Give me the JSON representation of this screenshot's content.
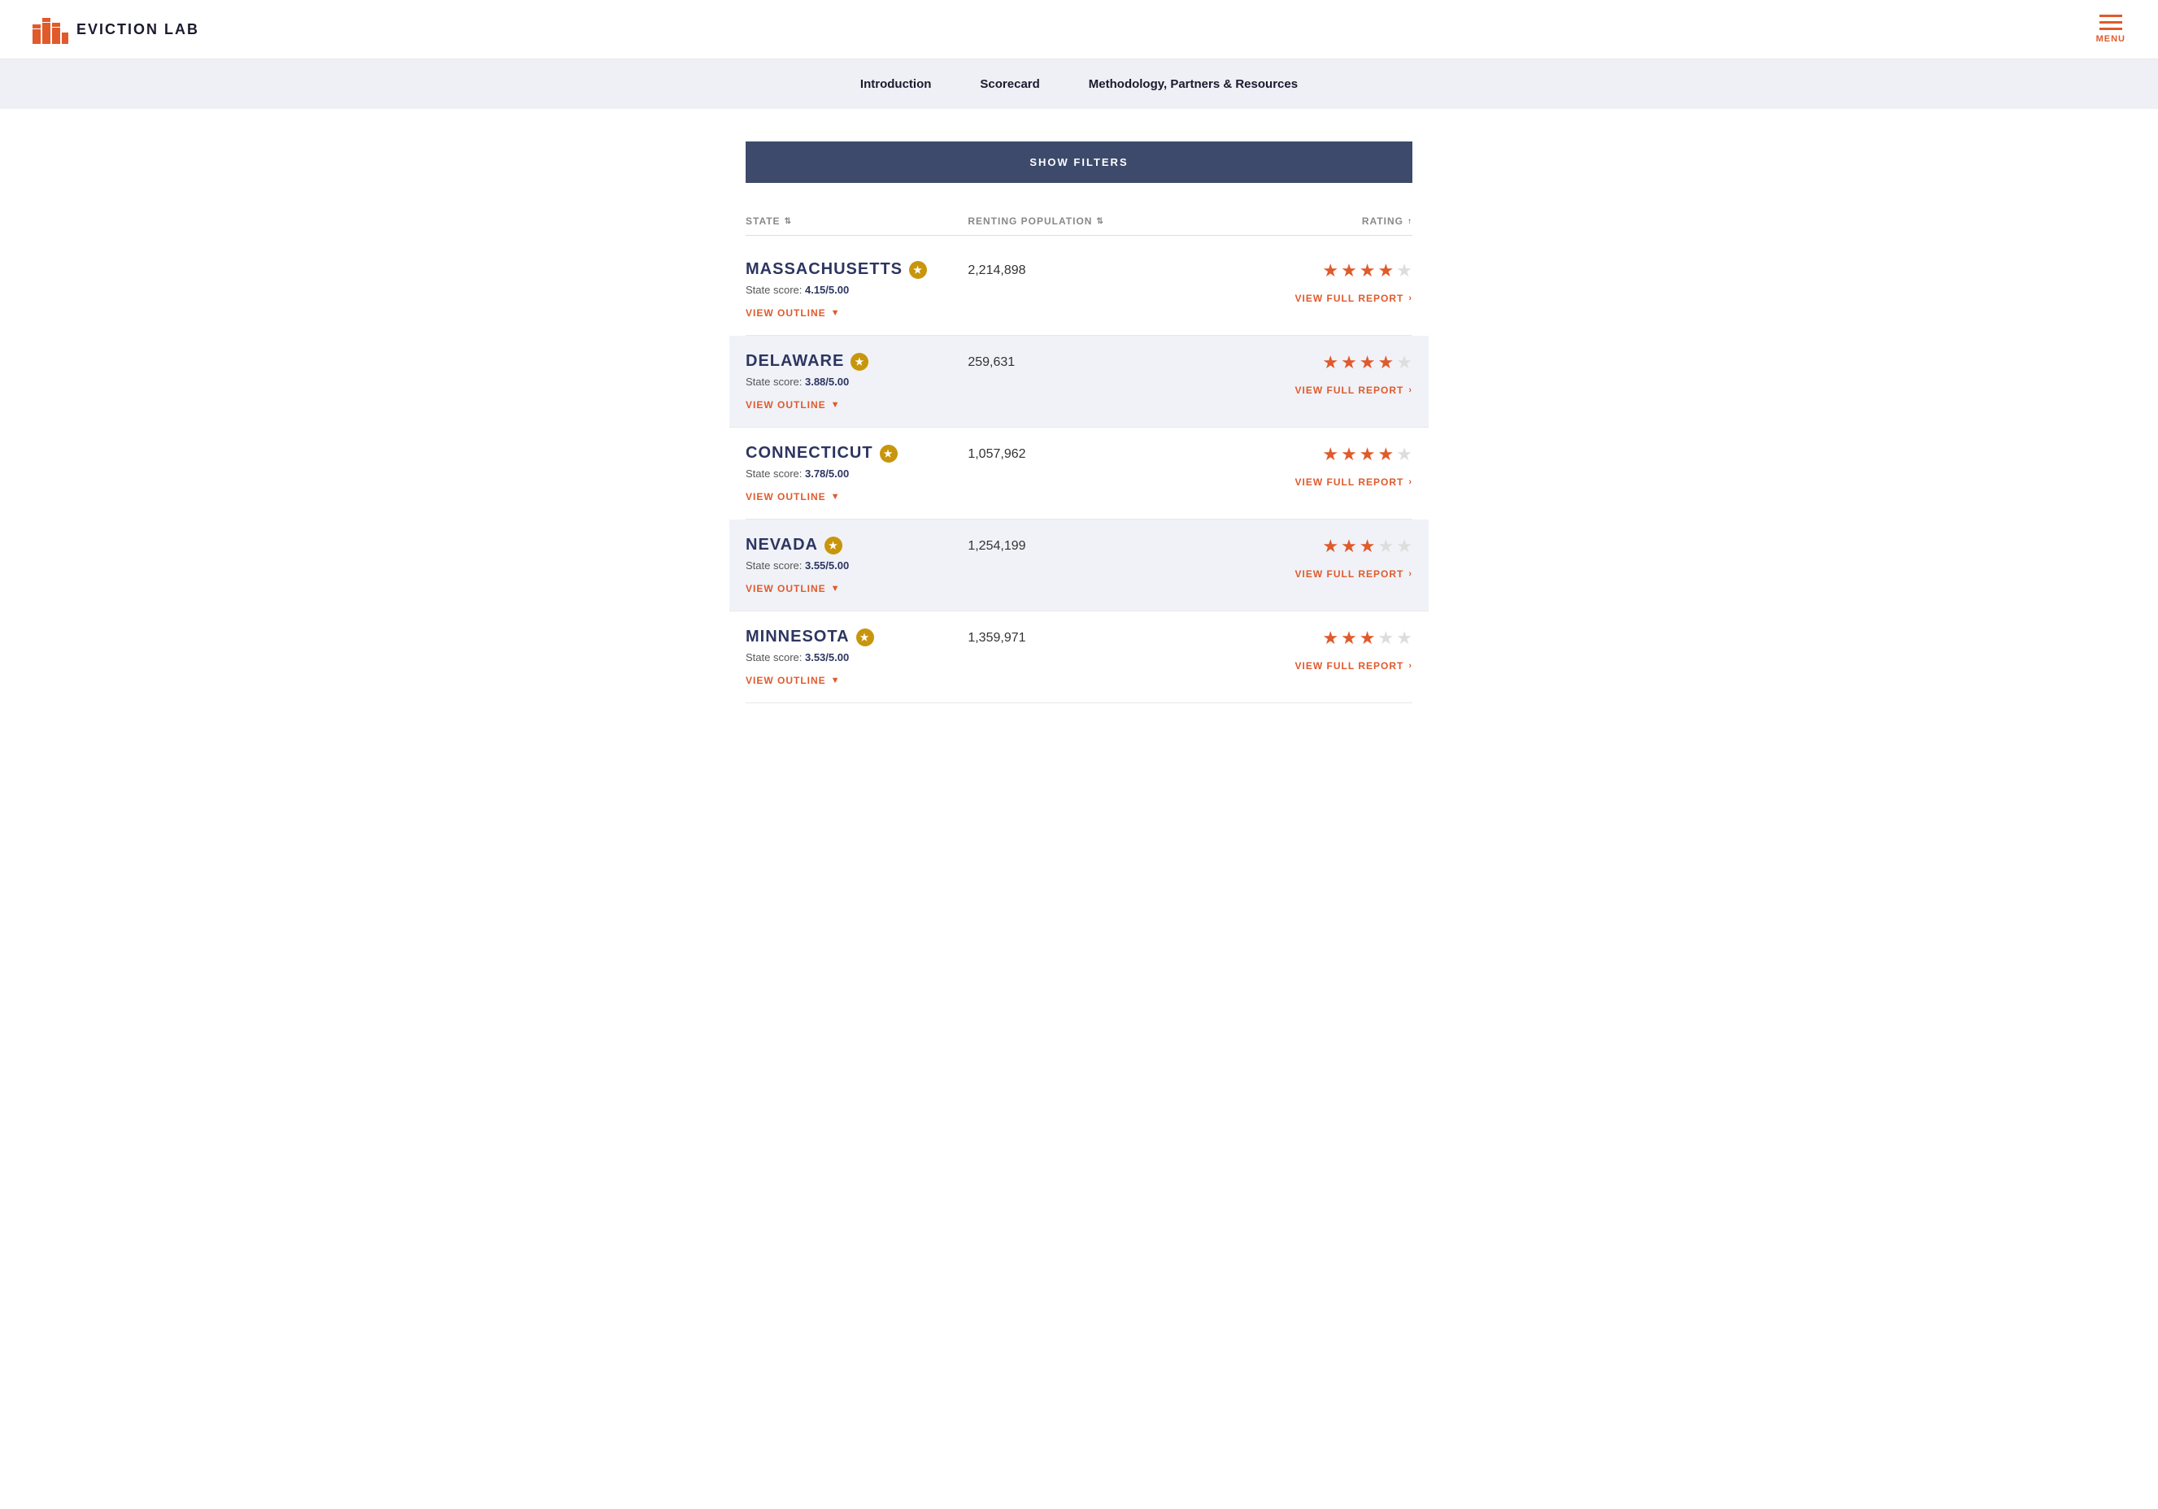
{
  "header": {
    "logo_text": "EVICTION LAB",
    "menu_label": "MENU"
  },
  "nav": {
    "items": [
      {
        "label": "Introduction",
        "id": "introduction"
      },
      {
        "label": "Scorecard",
        "id": "scorecard"
      },
      {
        "label": "Methodology, Partners & Resources",
        "id": "methodology"
      }
    ]
  },
  "filters_button": "SHOW FILTERS",
  "table": {
    "columns": [
      {
        "label": "STATE",
        "sort": "unsorted",
        "id": "state"
      },
      {
        "label": "RENTING POPULATION",
        "sort": "unsorted",
        "id": "renting-population"
      },
      {
        "label": "RATING",
        "sort": "descending",
        "id": "rating"
      }
    ],
    "rows": [
      {
        "state": "MASSACHUSETTS",
        "featured": true,
        "score": "4.15/5.00",
        "population": "2,214,898",
        "stars": [
          true,
          true,
          true,
          true,
          false
        ],
        "highlighted": false
      },
      {
        "state": "DELAWARE",
        "featured": true,
        "score": "3.88/5.00",
        "population": "259,631",
        "stars": [
          true,
          true,
          true,
          true,
          false
        ],
        "highlighted": true
      },
      {
        "state": "CONNECTICUT",
        "featured": true,
        "score": "3.78/5.00",
        "population": "1,057,962",
        "stars": [
          true,
          true,
          true,
          true,
          false
        ],
        "highlighted": false
      },
      {
        "state": "NEVADA",
        "featured": true,
        "score": "3.55/5.00",
        "population": "1,254,199",
        "stars": [
          true,
          true,
          true,
          false,
          false
        ],
        "highlighted": true
      },
      {
        "state": "MINNESOTA",
        "featured": true,
        "score": "3.53/5.00",
        "population": "1,359,971",
        "stars": [
          true,
          true,
          true,
          false,
          false
        ],
        "highlighted": false
      }
    ],
    "view_outline_label": "VIEW OUTLINE",
    "view_report_label": "VIEW FULL REPORT",
    "state_score_prefix": "State score: "
  }
}
